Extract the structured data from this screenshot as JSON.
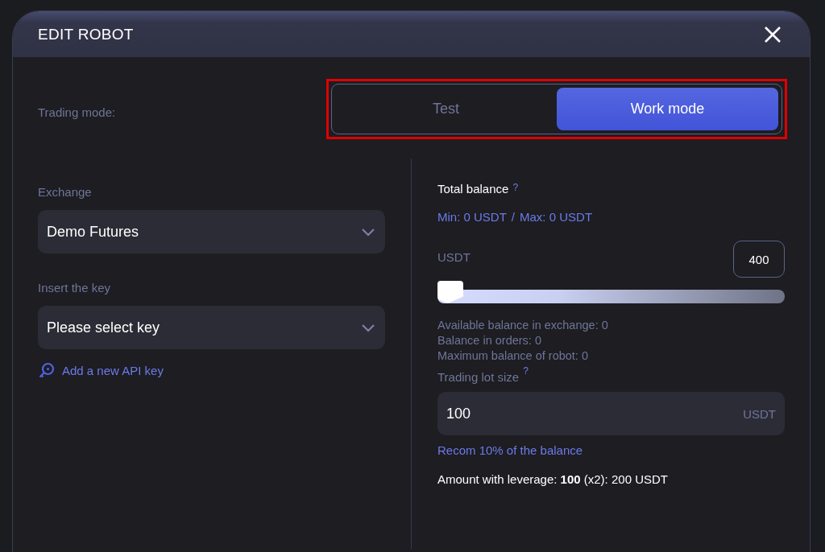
{
  "dialog": {
    "title": "EDIT ROBOT"
  },
  "trading_mode": {
    "label": "Trading mode:",
    "highlighted": true,
    "options": [
      {
        "label": "Test",
        "selected": false
      },
      {
        "label": "Work mode",
        "selected": true
      }
    ]
  },
  "exchange": {
    "label": "Exchange",
    "value": "Demo Futures"
  },
  "key": {
    "label": "Insert the key",
    "value": "Please select key"
  },
  "add_key_link": "Add a new API key",
  "total_balance": {
    "label": "Total balance",
    "help": "?",
    "min": "Min: 0 USDT",
    "separator": "/",
    "max": "Max: 0 USDT",
    "unit": "USDT",
    "value": "400",
    "level": 0
  },
  "balance_info": [
    "Available balance in exchange: 0",
    "Balance in orders: 0",
    "Maximum balance of robot: 0"
  ],
  "lot_size": {
    "label": "Trading lot size",
    "help": "?",
    "value": "100",
    "unit": "USDT",
    "hint": "Recom 10% of the balance"
  },
  "leverage": "Amount with leverage: **100** (x2): 200 USDT"
}
